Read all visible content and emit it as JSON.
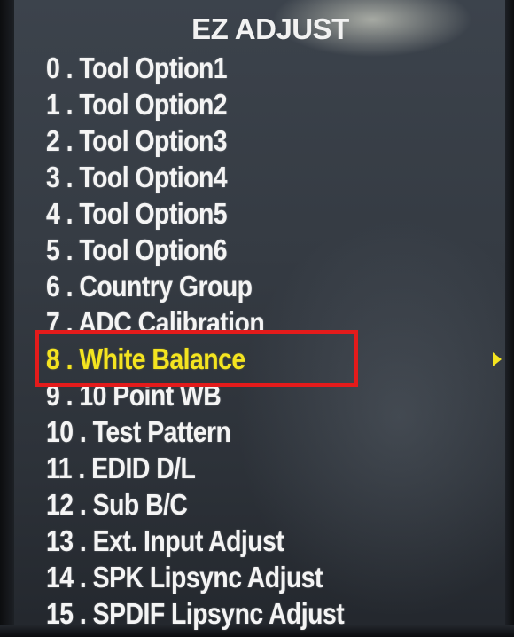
{
  "screen": {
    "title": "EZ ADJUST"
  },
  "menu": {
    "selected_index": 8,
    "items": [
      {
        "num": "0",
        "label": "Tool Option1"
      },
      {
        "num": "1",
        "label": "Tool Option2"
      },
      {
        "num": "2",
        "label": "Tool Option3"
      },
      {
        "num": "3",
        "label": "Tool Option4"
      },
      {
        "num": "4",
        "label": "Tool Option5"
      },
      {
        "num": "5",
        "label": "Tool Option6"
      },
      {
        "num": "6",
        "label": "Country Group"
      },
      {
        "num": "7",
        "label": "ADC Calibration"
      },
      {
        "num": "8",
        "label": "White Balance"
      },
      {
        "num": "9",
        "label": "10 Point WB"
      },
      {
        "num": "10",
        "label": "Test Pattern"
      },
      {
        "num": "11",
        "label": "EDID D/L"
      },
      {
        "num": "12",
        "label": "Sub B/C"
      },
      {
        "num": "13",
        "label": "Ext. Input Adjust"
      },
      {
        "num": "14",
        "label": "SPK Lipsync Adjust"
      },
      {
        "num": "15",
        "label": "SPDIF Lipsync Adjust"
      }
    ],
    "separator": " . "
  },
  "colors": {
    "selected_text": "#f4e420",
    "normal_text": "#f4f4f4",
    "highlight_box": "#e41b1b"
  },
  "icons": {
    "submenu_arrow": "triangle-right-icon"
  }
}
